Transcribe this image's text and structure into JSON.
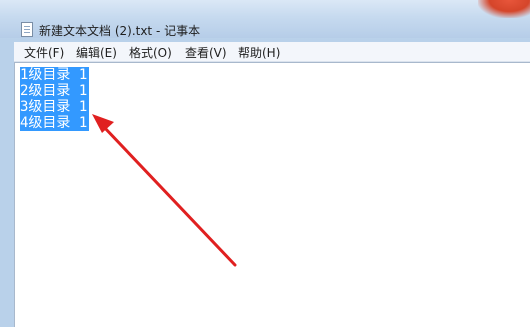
{
  "window": {
    "title": "新建文本文档 (2).txt - 记事本"
  },
  "menu": {
    "file": "文件(F)",
    "edit": "编辑(E)",
    "format": "格式(O)",
    "view": "查看(V)",
    "help": "帮助(H)"
  },
  "editor": {
    "lines": [
      "1级目录 1",
      "2级目录 1",
      "3级目录 1",
      "4级目录 1"
    ],
    "selection_color": "#3399ff"
  },
  "annotation": {
    "arrow_color": "#e02020"
  }
}
